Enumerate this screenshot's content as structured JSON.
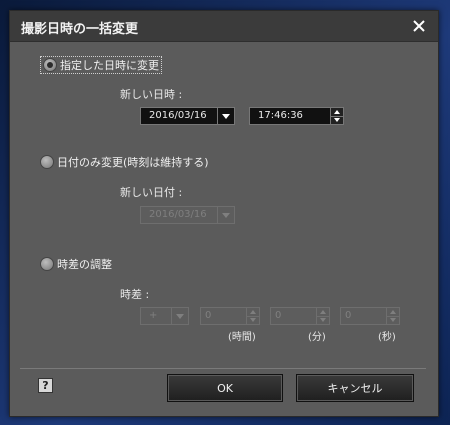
{
  "dialog": {
    "title": "撮影日時の一括変更",
    "close_icon": "close-icon"
  },
  "options": [
    {
      "label": "指定した日時に変更",
      "checked": true
    },
    {
      "label": "日付のみ変更(時刻は維持する)",
      "checked": false
    },
    {
      "label": "時差の調整",
      "checked": false
    }
  ],
  "specific": {
    "label": "新しい日時 :",
    "date": "2016/03/16",
    "time": "17:46:36"
  },
  "date_only": {
    "label": "新しい日付 :",
    "date": "2016/03/16"
  },
  "time_diff": {
    "label": "時差 :",
    "sign": "+",
    "hours": "0",
    "minutes": "0",
    "seconds": "0",
    "hours_unit": "(時間)",
    "minutes_unit": "(分)",
    "seconds_unit": "(秒)"
  },
  "footer": {
    "help_label": "?",
    "ok_label": "OK",
    "cancel_label": "キャンセル"
  }
}
